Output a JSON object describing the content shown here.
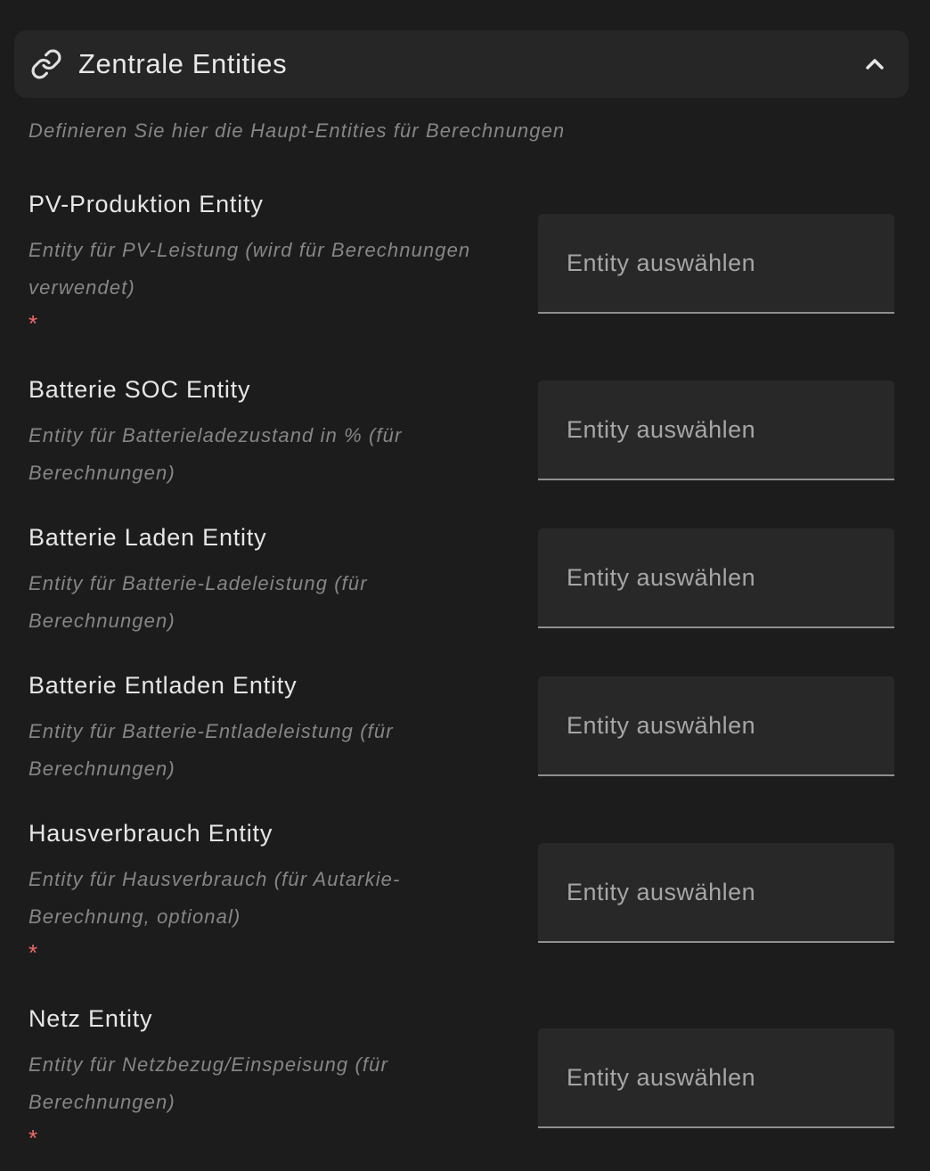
{
  "section": {
    "title": "Zentrale Entities",
    "description": "Definieren Sie hier die Haupt-Entities für Berechnungen",
    "expanded": true
  },
  "colors": {
    "background": "#1c1c1c",
    "header_background": "#262626",
    "required": "#f06a6a"
  },
  "fields": [
    {
      "label": "PV-Produktion Entity",
      "description": "Entity für PV-Leistung (wird für Berechnungen verwendet)",
      "required_mark": "*",
      "placeholder": "Entity auswählen"
    },
    {
      "label": "Batterie SOC Entity",
      "description": "Entity für Batterieladezustand in % (für Berechnungen)",
      "placeholder": "Entity auswählen"
    },
    {
      "label": "Batterie Laden Entity",
      "description": "Entity für Batterie-Ladeleistung (für Berechnungen)",
      "placeholder": "Entity auswählen"
    },
    {
      "label": "Batterie Entladen Entity",
      "description": "Entity für Batterie-Entladeleistung (für Berechnungen)",
      "placeholder": "Entity auswählen"
    },
    {
      "label": "Hausverbrauch Entity",
      "description": "Entity für Hausverbrauch (für Autarkie-Berechnung, optional)",
      "required_mark": "*",
      "placeholder": "Entity auswählen"
    },
    {
      "label": "Netz Entity",
      "description": "Entity für Netzbezug/Einspeisung (für Berechnungen)",
      "required_mark": "*",
      "placeholder": "Entity auswählen"
    }
  ]
}
